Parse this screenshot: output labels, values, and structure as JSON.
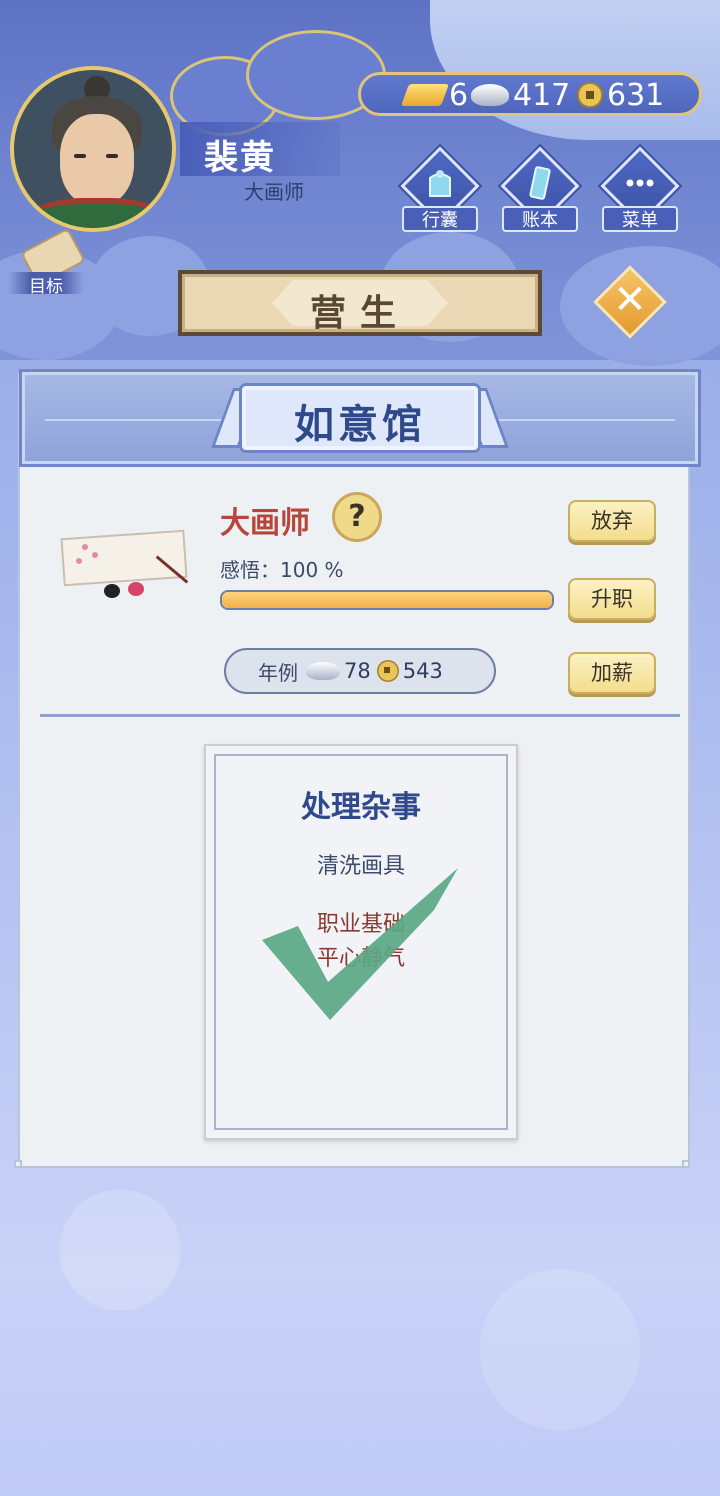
{
  "player": {
    "name": "裴黄",
    "title": "大画师"
  },
  "goal": {
    "label": "目标"
  },
  "currency": {
    "gold": "6",
    "silver": "417",
    "copper": "631"
  },
  "menu": [
    {
      "label": "行囊",
      "icon": "bag-icon"
    },
    {
      "label": "账本",
      "icon": "ledger-icon"
    },
    {
      "label": "菜单",
      "icon": "more-icon"
    }
  ],
  "header": {
    "title": "营生"
  },
  "shop": {
    "name": "如意馆"
  },
  "job": {
    "title": "大画师",
    "help": "?",
    "insight_label": "感悟：100 %",
    "insight_progress": 1.0,
    "abandon_label": "放弃",
    "promote_label": "升职",
    "raise_label": "加薪",
    "salary_label": "年例",
    "salary_silver": "78",
    "salary_copper": "543"
  },
  "task_card": {
    "title": "处理杂事",
    "task": "清洗画具",
    "line1": "职业基础",
    "line2": "平心静气",
    "completed": true
  },
  "colors": {
    "accent_gold": "#e6c870",
    "job_red": "#b8453a",
    "shop_blue": "#2f4a8a",
    "check_green": "#5aa884"
  }
}
